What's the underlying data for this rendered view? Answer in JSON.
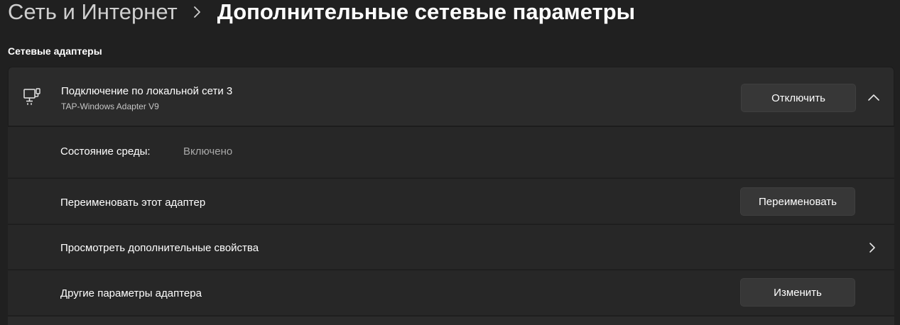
{
  "breadcrumb": {
    "parent": "Сеть и Интернет",
    "current": "Дополнительные сетевые параметры"
  },
  "section": {
    "title": "Сетевые адаптеры"
  },
  "adapter": {
    "icon": "network-adapter-icon",
    "name": "Подключение по локальной сети 3",
    "description": "TAP-Windows Adapter V9",
    "disable_button": "Отключить",
    "expanded": true
  },
  "rows": {
    "status": {
      "label": "Состояние среды:",
      "value": "Включено"
    },
    "rename": {
      "label": "Переименовать этот адаптер",
      "button": "Переименовать"
    },
    "properties": {
      "label": "Просмотреть дополнительные свойства"
    },
    "other": {
      "label": "Другие параметры адаптера",
      "button": "Изменить"
    }
  },
  "colors": {
    "background": "#202020",
    "card": "#2b2b2b",
    "button": "#373737",
    "text": "#ffffff",
    "secondary_text": "#a8a8a8"
  }
}
